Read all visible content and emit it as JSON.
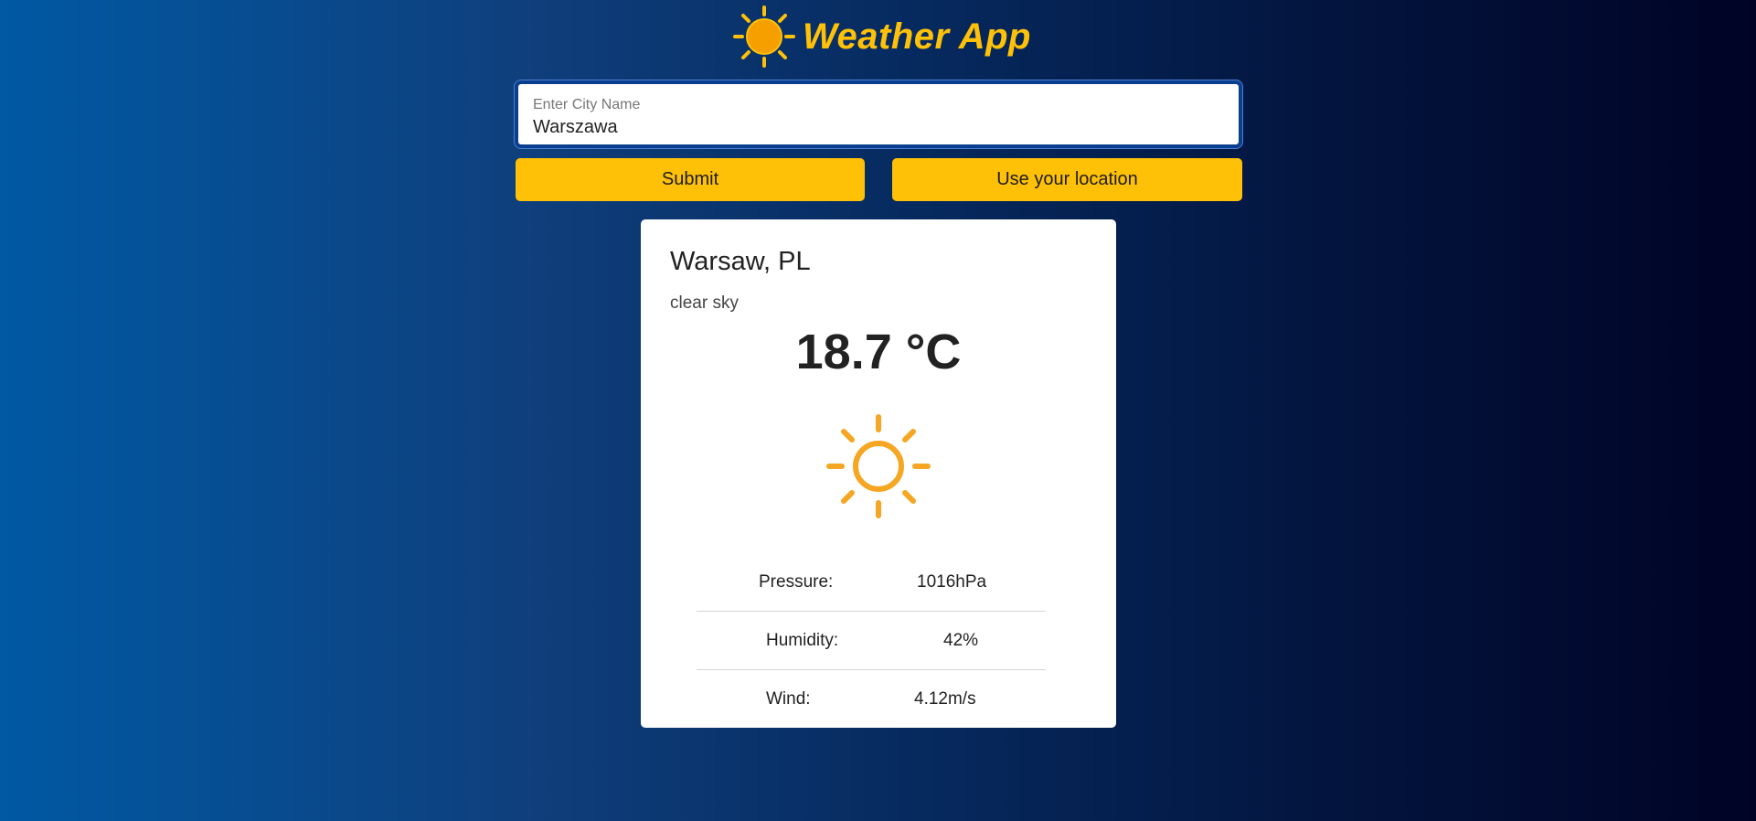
{
  "app": {
    "title": "Weather App",
    "logo_icon": "sun-icon"
  },
  "search": {
    "label": "Enter City Name",
    "value": "Warszawa"
  },
  "buttons": {
    "submit_label": "Submit",
    "location_label": "Use your location"
  },
  "weather": {
    "city": "Warsaw, PL",
    "description": "clear sky",
    "temperature": "18.7 °C",
    "icon": "clear-sky-sun-icon",
    "details": [
      {
        "label": "Pressure:",
        "value": "1016hPa"
      },
      {
        "label": "Humidity:",
        "value": "42%"
      },
      {
        "label": "Wind:",
        "value": "4.12m/s"
      }
    ]
  },
  "colors": {
    "accent": "#ffc107",
    "sun_icon": "#f5a623",
    "card_bg": "#ffffff",
    "background_left": "#0059a3",
    "background_right": "#000325"
  }
}
